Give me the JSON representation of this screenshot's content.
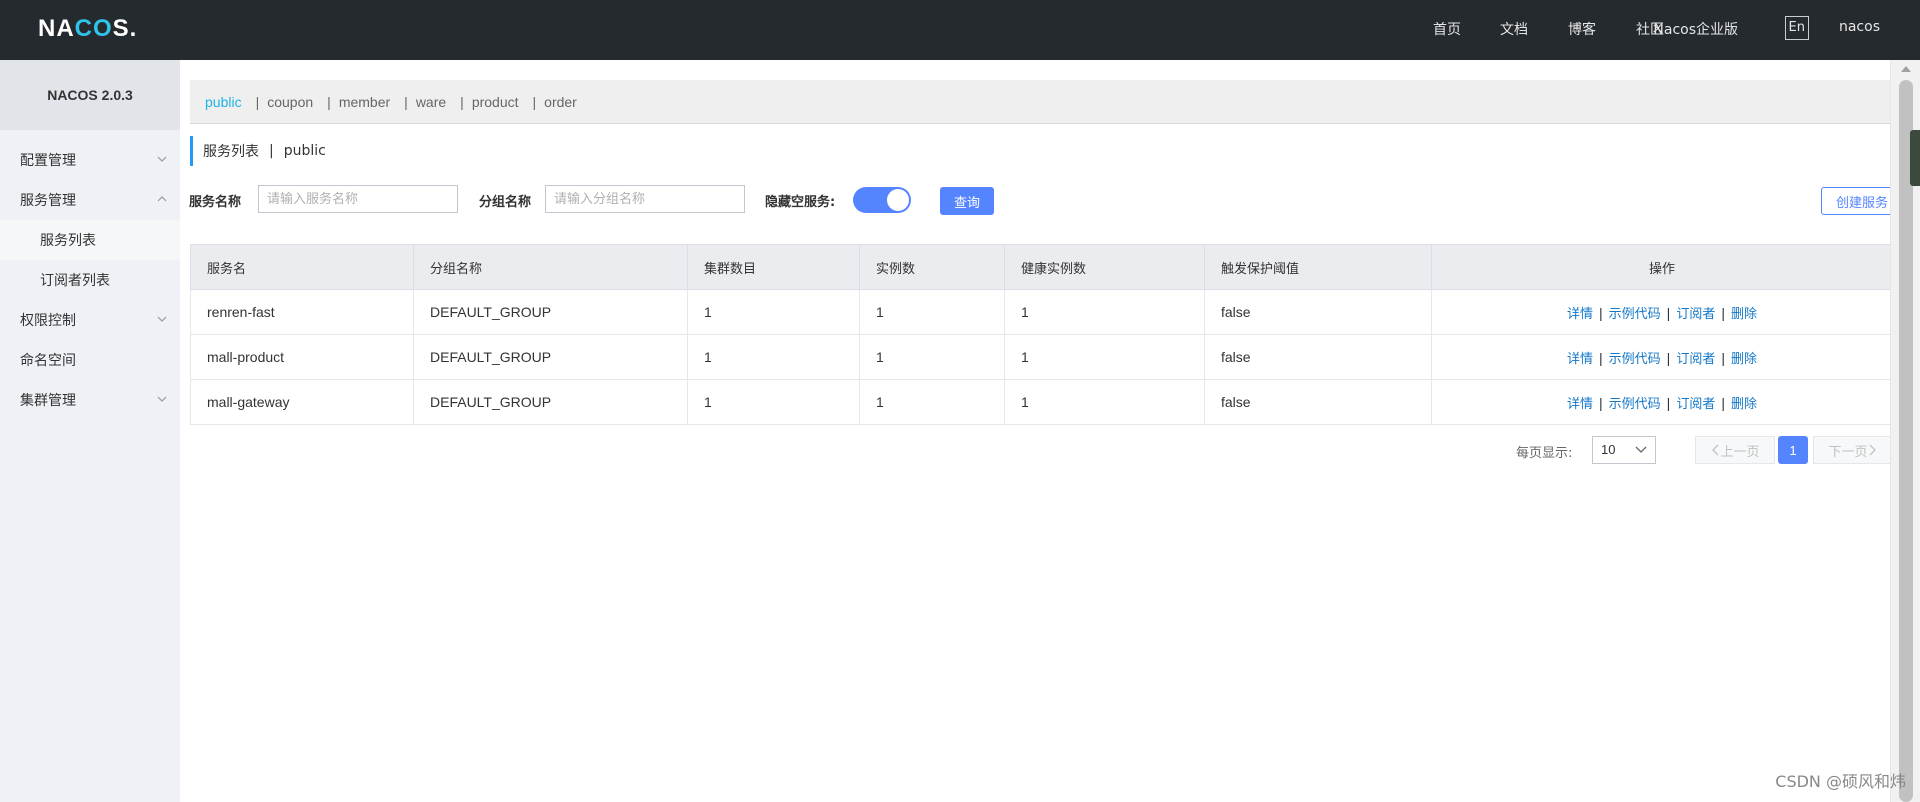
{
  "header": {
    "logo_main": "NA",
    "logo_accent": "CO",
    "logo_end": "S.",
    "nav": [
      "首页",
      "文档",
      "博客",
      "社区",
      "Nacos企业版"
    ],
    "lang": "En",
    "user": "nacos"
  },
  "sidebar": {
    "title": "NACOS 2.0.3",
    "items": [
      {
        "label": "配置管理"
      },
      {
        "label": "服务管理"
      },
      {
        "label": "服务列表"
      },
      {
        "label": "订阅者列表"
      },
      {
        "label": "权限控制"
      },
      {
        "label": "命名空间"
      },
      {
        "label": "集群管理"
      }
    ]
  },
  "namespaces": [
    "public",
    "coupon",
    "member",
    "ware",
    "product",
    "order"
  ],
  "page": {
    "title": "服务列表",
    "divider": "|",
    "namespace": "public"
  },
  "filter": {
    "service_label": "服务名称",
    "service_placeholder": "请输入服务名称",
    "group_label": "分组名称",
    "group_placeholder": "请输入分组名称",
    "hide_empty_label": "隐藏空服务:",
    "hide_empty_on": true,
    "query_label": "查询",
    "create_label": "创建服务"
  },
  "table": {
    "columns": [
      "服务名",
      "分组名称",
      "集群数目",
      "实例数",
      "健康实例数",
      "触发保护阈值",
      "操作"
    ],
    "rows": [
      [
        "renren-fast",
        "DEFAULT_GROUP",
        "1",
        "1",
        "1",
        "false"
      ],
      [
        "mall-product",
        "DEFAULT_GROUP",
        "1",
        "1",
        "1",
        "false"
      ],
      [
        "mall-gateway",
        "DEFAULT_GROUP",
        "1",
        "1",
        "1",
        "false"
      ]
    ],
    "actions": [
      "详情",
      "示例代码",
      "订阅者",
      "删除"
    ],
    "action_sep": "|"
  },
  "pager": {
    "page_size_label": "每页显示:",
    "page_size": "10",
    "prev_label": "上一页",
    "next_label": "下一页",
    "current_page": "1"
  },
  "watermark": "CSDN @硕风和炜",
  "colors": {
    "header_bg": "#252a2f",
    "primary": "#5584ff",
    "link": "#1478c9",
    "ns_active": "#21b2e6"
  }
}
